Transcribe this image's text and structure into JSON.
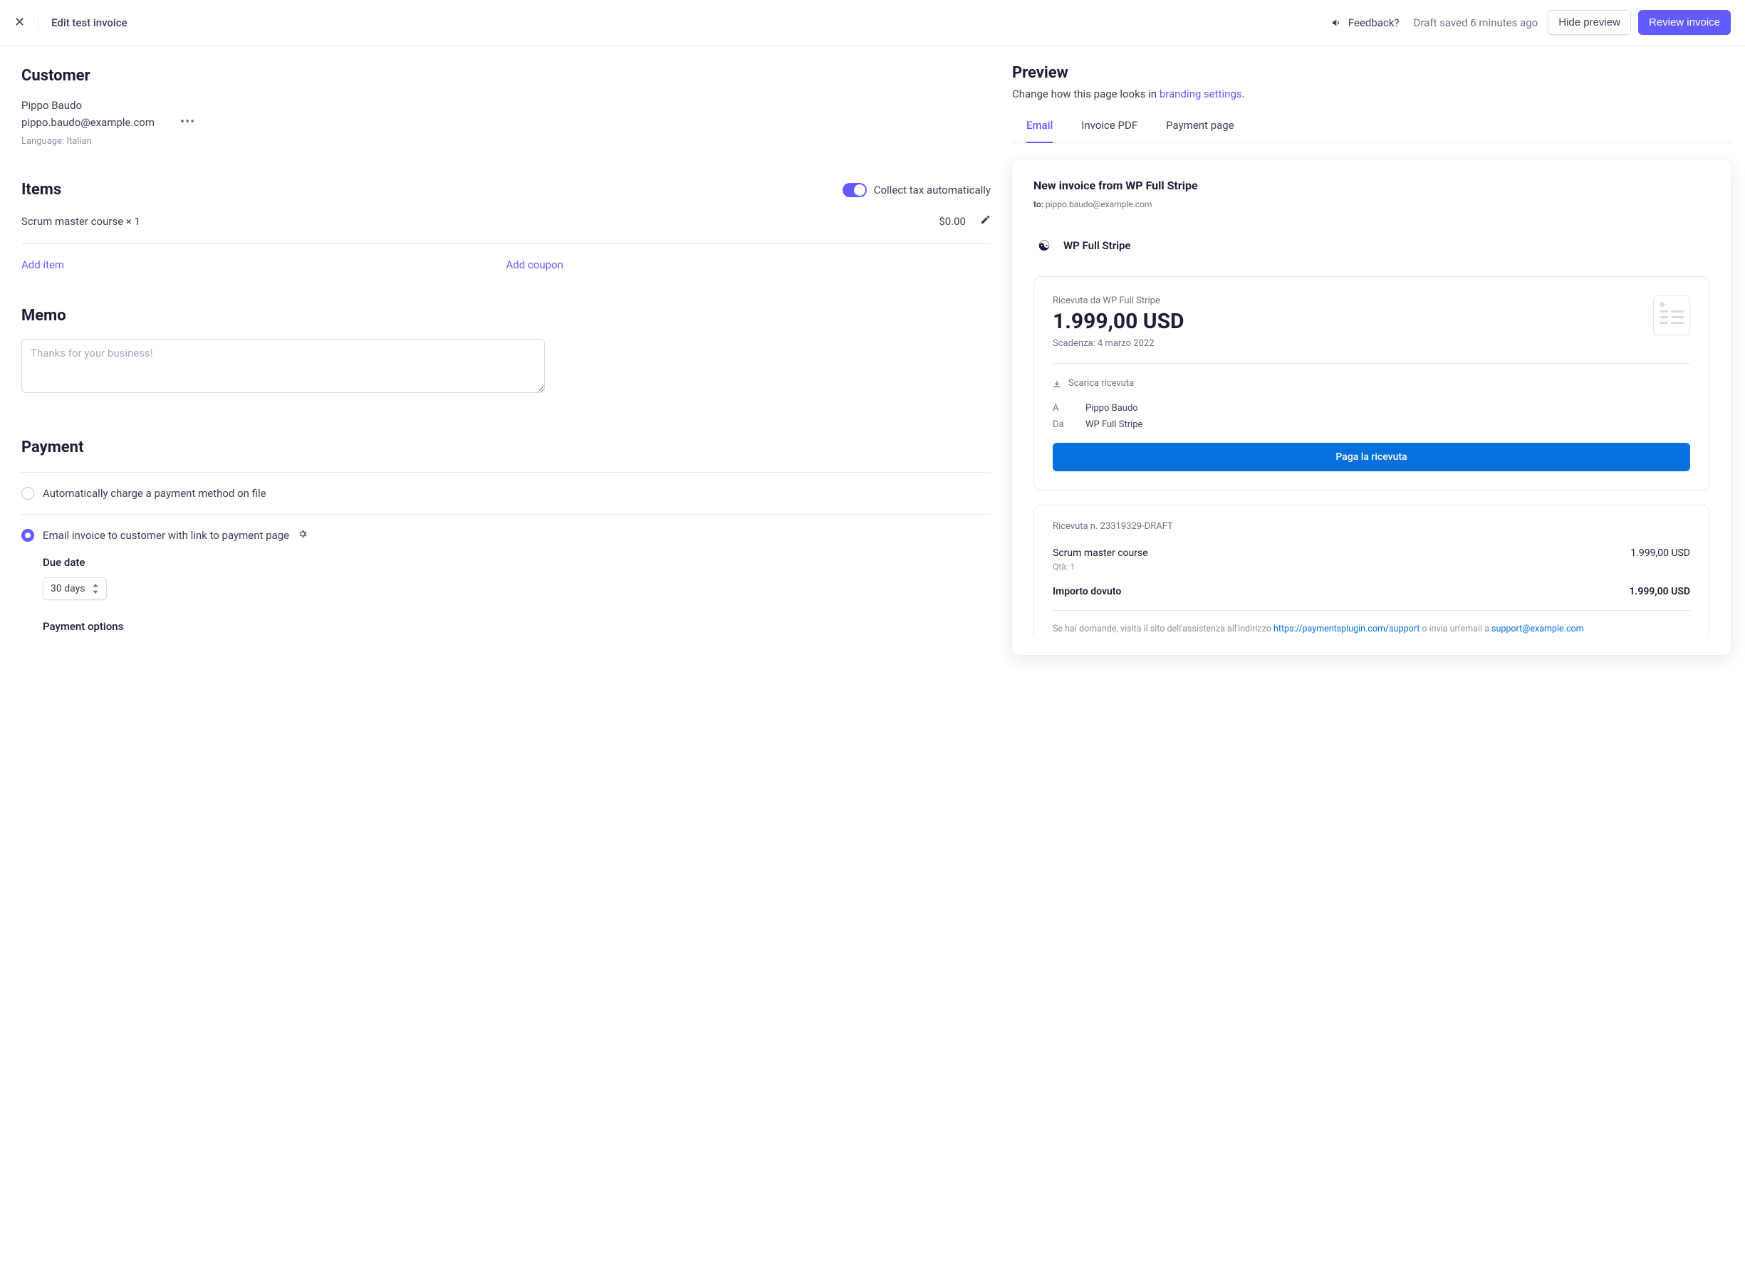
{
  "topbar": {
    "title": "Edit test invoice",
    "feedback": "Feedback?",
    "draft_saved": "Draft saved 6 minutes ago",
    "hide_preview": "Hide preview",
    "review": "Review invoice"
  },
  "customer": {
    "section_title": "Customer",
    "name": "Pippo Baudo",
    "email": "pippo.baudo@example.com",
    "language": "Language: Italian"
  },
  "items": {
    "section_title": "Items",
    "collect_tax_label": "Collect tax automatically",
    "line_name": "Scrum master course × 1",
    "line_price": "$0.00",
    "add_item": "Add item",
    "add_coupon": "Add coupon"
  },
  "memo": {
    "section_title": "Memo",
    "placeholder": "Thanks for your business!"
  },
  "payment": {
    "section_title": "Payment",
    "option_auto": "Automatically charge a payment method on file",
    "option_email": "Email invoice to customer with link to payment page",
    "due_date_label": "Due date",
    "due_date_value": "30 days",
    "payment_options_label": "Payment options"
  },
  "preview": {
    "title": "Preview",
    "sub_prefix": "Change how this page looks in ",
    "sub_link": "branding settings",
    "sub_suffix": ".",
    "tabs": {
      "email": "Email",
      "pdf": "Invoice PDF",
      "payment_page": "Payment page"
    },
    "email": {
      "subject": "New invoice from WP Full Stripe",
      "to_label": "to:",
      "to_value": "pippo.baudo@example.com",
      "merchant": "WP Full Stripe",
      "receipt": {
        "from": "Ricevuta da WP Full Stripe",
        "amount": "1.999,00 USD",
        "due": "Scadenza: 4 marzo 2022",
        "download": "Scarica ricevuta",
        "a_label": "A",
        "a_value": "Pippo Baudo",
        "da_label": "Da",
        "da_value": "WP Full Stripe",
        "pay_btn": "Paga la ricevuta"
      },
      "lines": {
        "receipt_no": "Ricevuta n. 23319329-DRAFT",
        "item_name": "Scrum master course",
        "item_amount": "1.999,00 USD",
        "qty": "Qtà: 1",
        "total_label": "Importo dovuto",
        "total_amount": "1.999,00 USD",
        "support_prefix": "Se hai domande, visita il sito dell'assistenza all'indirizzo ",
        "support_link": "https://paymentsplugin.com/support",
        "support_mid": " o invia un'email a ",
        "support_email": "support@example.com"
      }
    }
  }
}
